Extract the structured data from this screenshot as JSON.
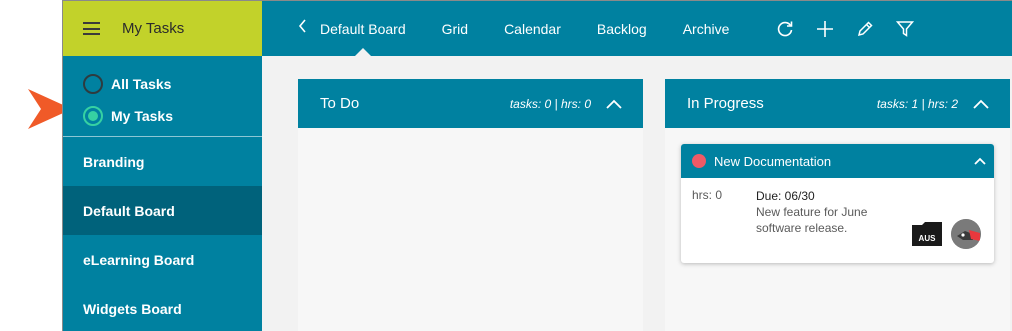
{
  "sidebar": {
    "title": "My Tasks",
    "radios": [
      {
        "label": "All Tasks",
        "checked": false
      },
      {
        "label": "My Tasks",
        "checked": true
      }
    ],
    "boards": [
      {
        "label": "Branding",
        "active": false
      },
      {
        "label": "Default Board",
        "active": true
      },
      {
        "label": "eLearning Board",
        "active": false
      },
      {
        "label": "Widgets Board",
        "active": false
      }
    ]
  },
  "topbar": {
    "back_icon": "chevron-left-icon",
    "tabs": [
      {
        "label": "Default Board",
        "active": true
      },
      {
        "label": "Grid",
        "active": false
      },
      {
        "label": "Calendar",
        "active": false
      },
      {
        "label": "Backlog",
        "active": false
      },
      {
        "label": "Archive",
        "active": false
      }
    ],
    "tools": [
      "refresh-icon",
      "plus-icon",
      "pencil-icon",
      "filter-icon"
    ]
  },
  "columns": [
    {
      "title": "To Do",
      "stats": "tasks: 0 | hrs: 0",
      "cards": []
    },
    {
      "title": "In Progress",
      "stats": "tasks: 1 | hrs: 2",
      "cards": [
        {
          "title": "New Documentation",
          "status_color": "#ef5a66",
          "hrs": "hrs: 0",
          "due": "Due: 06/30",
          "description": "New feature for June software release.",
          "folder_label": "AUS"
        }
      ]
    }
  ],
  "colors": {
    "primary": "#0081a0",
    "primary_dark": "#00627b",
    "accent_lime": "#c2d22a",
    "radio_checked": "#36d1a2",
    "callout": "#f05a28"
  }
}
